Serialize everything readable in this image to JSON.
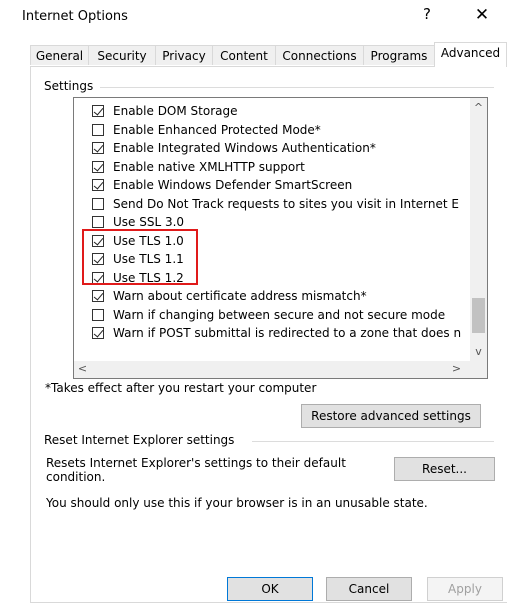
{
  "window": {
    "title": "Internet Options",
    "help_label": "?",
    "close_label": "✕"
  },
  "tabs": [
    {
      "label": "General"
    },
    {
      "label": "Security"
    },
    {
      "label": "Privacy"
    },
    {
      "label": "Content"
    },
    {
      "label": "Connections"
    },
    {
      "label": "Programs"
    },
    {
      "label": "Advanced",
      "active": true
    }
  ],
  "settings": {
    "group_label": "Settings",
    "items": [
      {
        "label": "Enable DOM Storage",
        "checked": true
      },
      {
        "label": "Enable Enhanced Protected Mode*",
        "checked": false
      },
      {
        "label": "Enable Integrated Windows Authentication*",
        "checked": true
      },
      {
        "label": "Enable native XMLHTTP support",
        "checked": true
      },
      {
        "label": "Enable Windows Defender SmartScreen",
        "checked": true
      },
      {
        "label": "Send Do Not Track requests to sites you visit in Internet E",
        "checked": false
      },
      {
        "label": "Use SSL 3.0",
        "checked": false
      },
      {
        "label": "Use TLS 1.0",
        "checked": true
      },
      {
        "label": "Use TLS 1.1",
        "checked": true
      },
      {
        "label": "Use TLS 1.2",
        "checked": true
      },
      {
        "label": "Warn about certificate address mismatch*",
        "checked": true
      },
      {
        "label": "Warn if changing between secure and not secure mode",
        "checked": false
      },
      {
        "label": "Warn if POST submittal is redirected to a zone that does n",
        "checked": true
      }
    ],
    "scroll_up": "^",
    "scroll_down": "v",
    "scroll_left": "<",
    "scroll_right": ">",
    "footnote": "*Takes effect after you restart your computer",
    "restore_label": "Restore advanced settings"
  },
  "reset": {
    "group_label": "Reset Internet Explorer settings",
    "description": "Resets Internet Explorer's settings to their default condition.",
    "button_label": "Reset...",
    "note": "You should only use this if your browser is in an unusable state."
  },
  "footer": {
    "ok_label": "OK",
    "cancel_label": "Cancel",
    "apply_label": "Apply"
  }
}
